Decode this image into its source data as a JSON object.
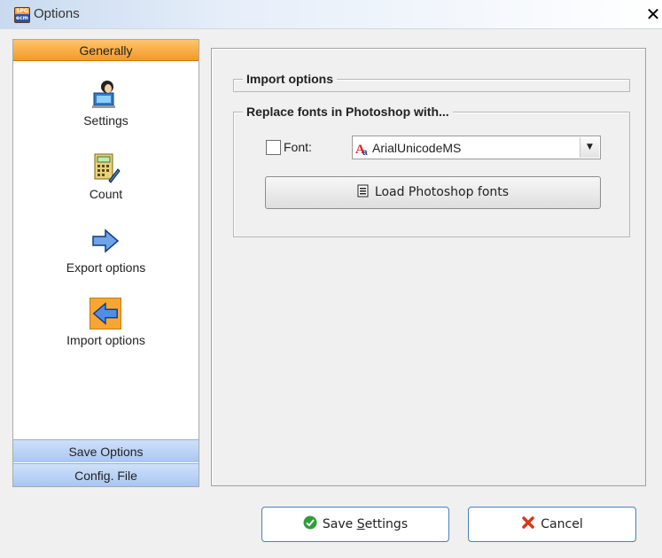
{
  "window": {
    "title": "Options",
    "app_icon_text": "SPG ecm",
    "close_glyph": "✕"
  },
  "nav": {
    "header": "Generally",
    "items": [
      {
        "label": "Settings",
        "icon": "user-at-computer-icon",
        "selected": false
      },
      {
        "label": "Count",
        "icon": "calculator-icon",
        "selected": false
      },
      {
        "label": "Export options",
        "icon": "arrow-right-icon",
        "selected": false
      },
      {
        "label": "Import options",
        "icon": "arrow-left-icon",
        "selected": true
      }
    ],
    "footer": [
      {
        "label": "Save Options"
      },
      {
        "label": "Config. File"
      }
    ]
  },
  "content": {
    "import_group_title": "Import options",
    "replace_group_title": "Replace fonts in Photoshop with...",
    "font_checkbox_label": "Font:",
    "font_checked": false,
    "font_select_value": "ArialUnicodeMS",
    "load_fonts_button": "Load Photoshop fonts"
  },
  "footer": {
    "save_button_prefix": "Save ",
    "save_button_mnemonic": "S",
    "save_button_suffix": "ettings",
    "cancel_button": "Cancel"
  },
  "colors": {
    "nav_header": "#f29a26",
    "nav_footer": "#a9c6f1",
    "selected_icon_bg": "#f7a634",
    "button_border": "#4d7fbf"
  }
}
